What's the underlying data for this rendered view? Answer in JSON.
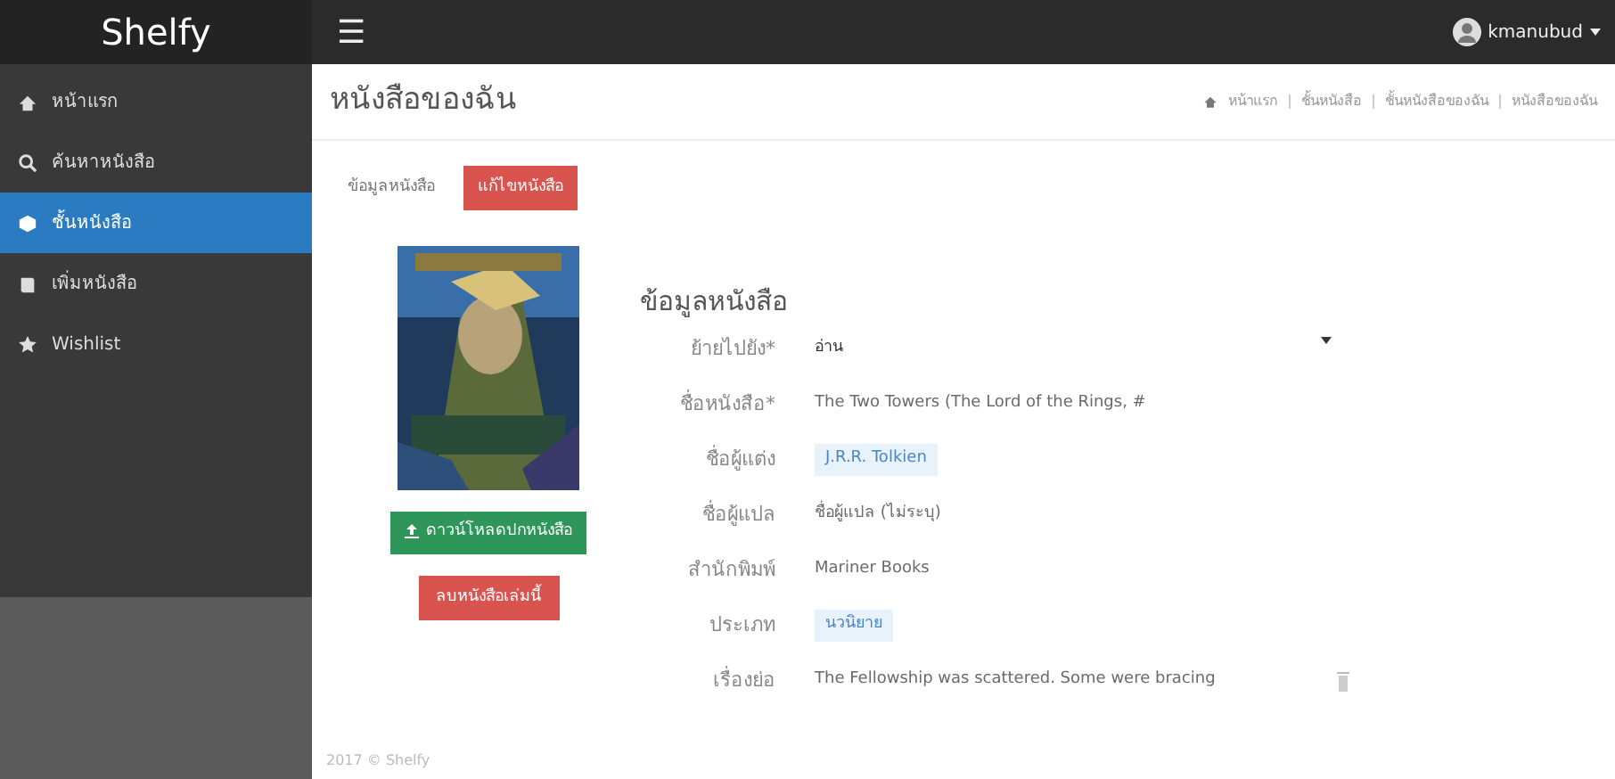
{
  "brand": "Shelfy",
  "menu_icon": "☰",
  "user": {
    "name": "kmanubud"
  },
  "sidebar": {
    "items": [
      {
        "label": "หน้าแรก",
        "selected": false
      },
      {
        "label": "ค้นหาหนังสือ",
        "selected": false
      },
      {
        "label": "ชั้นหนังสือ",
        "selected": true
      },
      {
        "label": "เพิ่มหนังสือ",
        "selected": false
      },
      {
        "label": "Wishlist",
        "selected": false
      }
    ]
  },
  "page_title": "หนังสือของฉัน",
  "breadcrumb": [
    "หน้าแรก",
    "ชั้นหนังสือ",
    "ชั้นหนังสือของฉัน",
    "หนังสือของฉัน"
  ],
  "tabs": [
    {
      "label": "ข้อมูลหนังสือ",
      "selected": false
    },
    {
      "label": "แก้ไขหนังสือ",
      "selected": true
    }
  ],
  "cover": {
    "kind": "picture"
  },
  "buttons": [
    {
      "label": "ดาวน์โหลดปกหนังสือ",
      "kind": "download"
    },
    {
      "label": "ลบหนังสือเล่มนี้",
      "kind": "delete"
    }
  ],
  "form": {
    "heading": "ข้อมูลหนังสือ",
    "fields": [
      {
        "label": "ย้ายไปยัง*",
        "kind": "select",
        "value": "อ่าน"
      },
      {
        "label": "ชื่อหนังสือ*",
        "kind": "text",
        "value": "The Two Towers (The Lord of the Rings, #"
      },
      {
        "label": "ชื่อผู้แต่ง",
        "kind": "tag",
        "value": "J.R.R. Tolkien"
      },
      {
        "label": "ชื่อผู้แปล",
        "kind": "text",
        "value": "ชื่อผู้แปล (ไม่ระบุ)"
      },
      {
        "label": "สำนักพิมพ์",
        "kind": "text",
        "value": "Mariner Books"
      },
      {
        "label": "ประเภท",
        "kind": "tag",
        "value": "นวนิยาย"
      },
      {
        "label": "เรื่องย่อ",
        "kind": "textarea",
        "value": "The Fellowship was scattered. Some were bracing"
      }
    ]
  },
  "footer": "2017 © Shelfy"
}
